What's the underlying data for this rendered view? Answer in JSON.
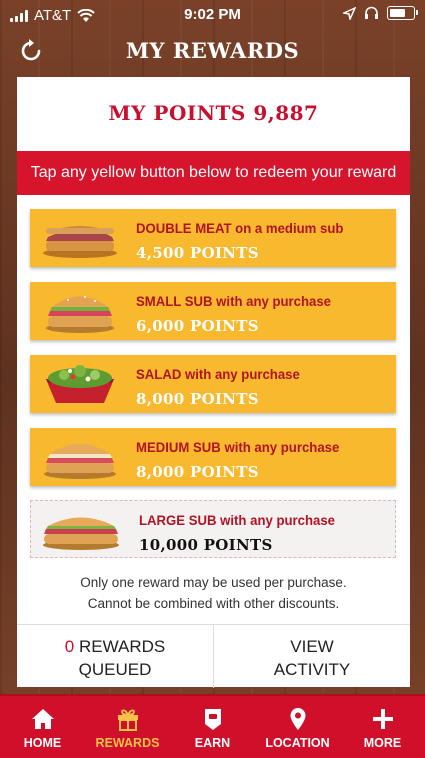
{
  "status_bar": {
    "carrier": "AT&T",
    "time": "9:02 PM"
  },
  "header": {
    "title": "MY REWARDS"
  },
  "points": {
    "label": "MY POINTS",
    "value": "9,887"
  },
  "banner": "Tap any yellow button below to redeem your reward",
  "rewards": [
    {
      "name": "DOUBLE MEAT on a medium sub",
      "points": "4,500 POINTS",
      "available": true,
      "thumb": "double-meat-sub"
    },
    {
      "name": "SMALL SUB with any purchase",
      "points": "6,000 POINTS",
      "available": true,
      "thumb": "small-sub"
    },
    {
      "name": "SALAD with any purchase",
      "points": "8,000 POINTS",
      "available": true,
      "thumb": "salad"
    },
    {
      "name": "MEDIUM SUB with any purchase",
      "points": "8,000 POINTS",
      "available": true,
      "thumb": "medium-sub"
    },
    {
      "name": "LARGE SUB with any purchase",
      "points": "10,000 POINTS",
      "available": false,
      "thumb": "large-sub"
    }
  ],
  "note": {
    "line1": "Only one reward may be used per purchase.",
    "line2": "Cannot be combined with other discounts."
  },
  "queued": {
    "count": "0",
    "label1": "REWARDS",
    "label2": "QUEUED"
  },
  "activity": {
    "label1": "VIEW",
    "label2": "ACTIVITY"
  },
  "tabs": [
    {
      "label": "HOME",
      "icon": "home-icon"
    },
    {
      "label": "REWARDS",
      "icon": "gift-icon",
      "active": true
    },
    {
      "label": "EARN",
      "icon": "earn-tag-icon"
    },
    {
      "label": "LOCATION",
      "icon": "location-pin-icon"
    },
    {
      "label": "MORE",
      "icon": "plus-icon"
    }
  ],
  "colors": {
    "brand_red": "#d0102a",
    "reward_yellow": "#f9b92e",
    "active_tab": "#f7c14a"
  }
}
